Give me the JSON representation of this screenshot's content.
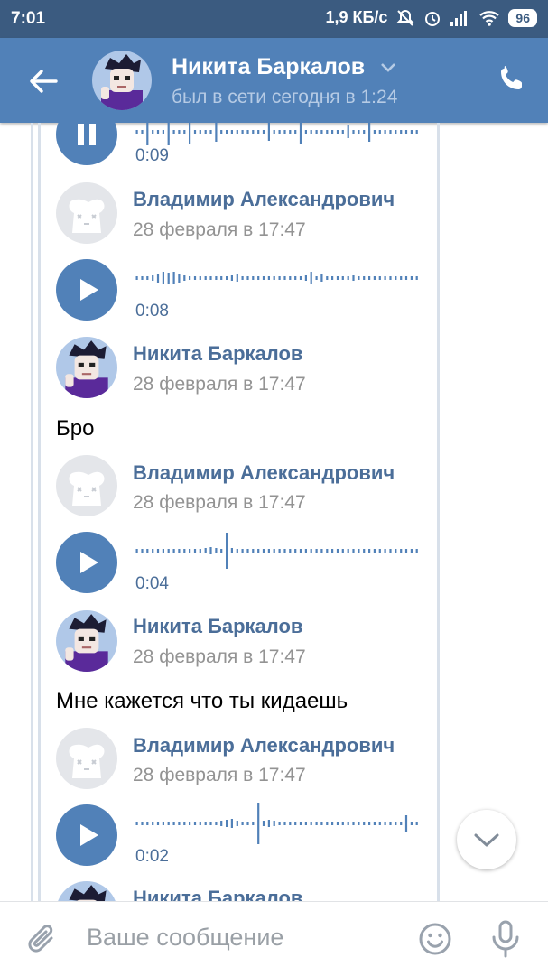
{
  "status_bar": {
    "time": "7:01",
    "speed": "1,9 КБ/с",
    "battery": "96"
  },
  "header": {
    "name": "Никита Баркалов",
    "status": "был в сети сегодня в 1:24"
  },
  "messages": [
    {
      "kind": "voice",
      "duration": "0:09",
      "state": "pause",
      "wave_ends": 0.96
    },
    {
      "kind": "sender",
      "name": "Владимир Александрович",
      "date": "28 февраля в 17:47",
      "avatar": "deactivated-dog"
    },
    {
      "kind": "voice",
      "duration": "0:08",
      "state": "play",
      "wave_ends": 0.96
    },
    {
      "kind": "sender",
      "name": "Никита Баркалов",
      "date": "28 февраля в 17:47",
      "avatar": "anime"
    },
    {
      "kind": "text",
      "text": "Бро"
    },
    {
      "kind": "sender",
      "name": "Владимир Александрович",
      "date": "28 февраля в 17:47",
      "avatar": "deactivated-dog"
    },
    {
      "kind": "voice",
      "duration": "0:04",
      "state": "play",
      "wave_ends": 0.96
    },
    {
      "kind": "sender",
      "name": "Никита Баркалов",
      "date": "28 февраля в 17:47",
      "avatar": "anime"
    },
    {
      "kind": "text",
      "text": "Мне кажется что ты кидаешь"
    },
    {
      "kind": "sender",
      "name": "Владимир Александрович",
      "date": "28 февраля в 17:47",
      "avatar": "deactivated-dog"
    },
    {
      "kind": "voice",
      "duration": "0:02",
      "state": "play",
      "wave_ends": 0.96
    },
    {
      "kind": "sender",
      "name": "Никита Баркалов",
      "date": "",
      "avatar": "anime"
    }
  ],
  "composer": {
    "placeholder": "Ваше сообщение"
  },
  "colors": {
    "accent": "#5181b8",
    "status_bar": "#3b5b80",
    "sender": "#4b6e99",
    "date": "#939393"
  }
}
